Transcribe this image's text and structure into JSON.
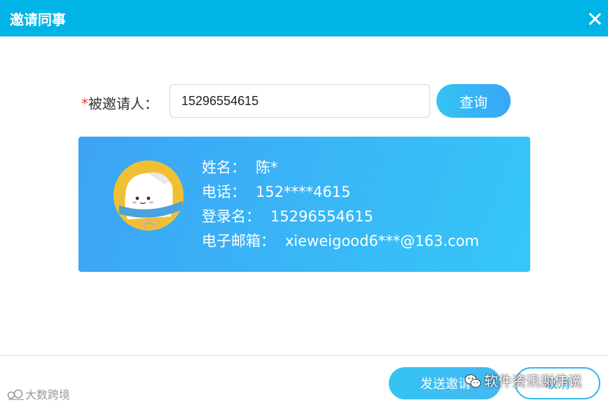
{
  "dialog": {
    "title": "邀请同事"
  },
  "form": {
    "required_mark": "*",
    "label": "被邀请人：",
    "phone_value": "15296554615",
    "query_label": "查询"
  },
  "user_card": {
    "name_key": "姓名：",
    "name_value": "陈*",
    "phone_key": "电话：",
    "phone_value": "152****4615",
    "login_key": "登录名：",
    "login_value": "15296554615",
    "email_key": "电子邮箱：",
    "email_value": "xieweigood6***@163.com"
  },
  "footer": {
    "send_label": "发送邀请",
    "cancel_label": "取消"
  },
  "watermarks": {
    "right": "软件资讯谢伟说",
    "left": "大数跨境"
  },
  "colors": {
    "titlebar": "#00b4e6",
    "card_start": "#3da3f5",
    "card_end": "#36c7f7",
    "required": "#ff3b30"
  }
}
